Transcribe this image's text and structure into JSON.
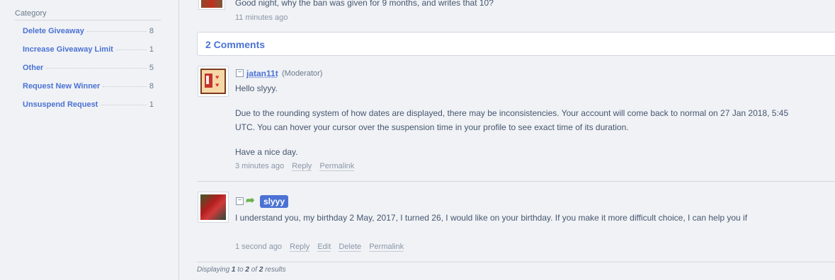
{
  "sidebar": {
    "heading": "Category",
    "items": [
      {
        "label": "Delete Giveaway",
        "count": "8"
      },
      {
        "label": "Increase Giveaway Limit",
        "count": "1"
      },
      {
        "label": "Other",
        "count": "5"
      },
      {
        "label": "Request New Winner",
        "count": "8"
      },
      {
        "label": "Unsuspend Request",
        "count": "1"
      }
    ]
  },
  "previous_post": {
    "text": "Good night, why the ban was given for 9 months, and writes that 10?",
    "time": "11 minutes ago"
  },
  "comments": {
    "title": "2 Comments",
    "items": [
      {
        "username": "jatan11t",
        "role": "(Moderator)",
        "collapse": "−",
        "paragraphs": [
          "Hello slyyy.",
          "Due to the rounding system of how dates are displayed, there may be inconsistencies. Your account will come back to normal on 27 Jan 2018, 5:45 UTC. You can hover your cursor over the suspension time in your profile to see exact time of its duration.",
          "Have a nice day."
        ],
        "time": "3 minutes ago",
        "actions": {
          "reply": "Reply",
          "permalink": "Permalink"
        }
      },
      {
        "username": "slyyy",
        "collapse": "−",
        "reply_arrow": "➦",
        "text": "I understand you, my birthday 2 May, 2017, I turned 26, I would like on your birthday. If you make it more difficult choice, I can help you if",
        "time": "1 second ago",
        "actions": {
          "reply": "Reply",
          "edit": "Edit",
          "delete": "Delete",
          "permalink": "Permalink"
        }
      }
    ]
  },
  "pagination": {
    "prefix": "Displaying",
    "from": "1",
    "to_word": "to",
    "to": "2",
    "of_word": "of",
    "total": "2",
    "suffix": "results"
  }
}
